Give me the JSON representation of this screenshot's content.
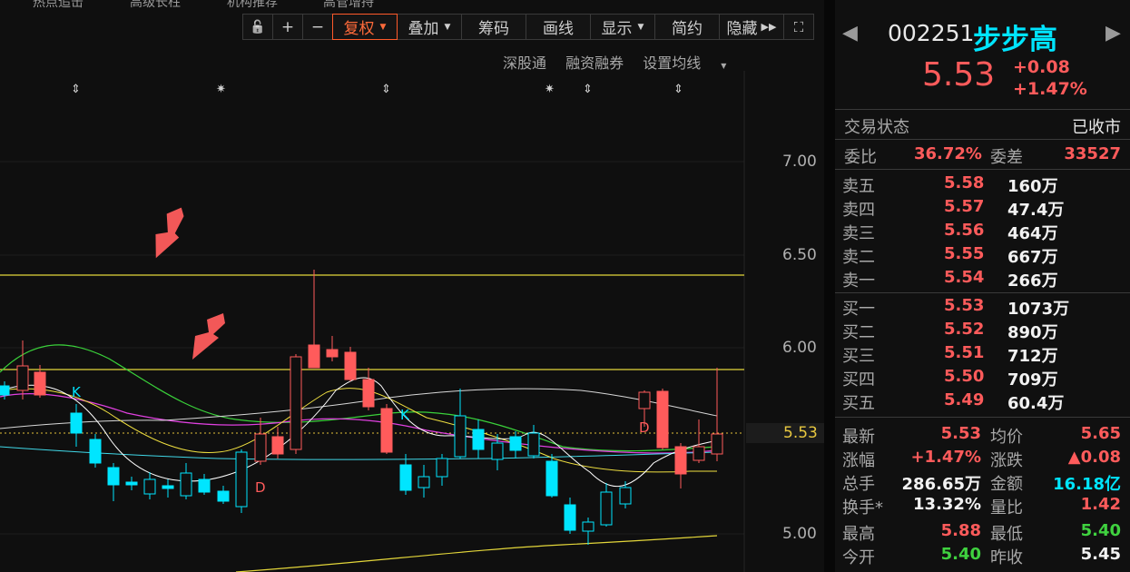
{
  "top_nav": [
    "热点追击",
    "高级长柱",
    "机构推荐",
    "高管增持"
  ],
  "toolbar": {
    "lock": "🔓",
    "plus": "+",
    "minus": "−",
    "fuquan": "复权",
    "diejia": "叠加",
    "chouma": "筹码",
    "huaxian": "画线",
    "xianshi": "显示",
    "jianyue": "简约",
    "yincang": "隐藏"
  },
  "subtoolbar": {
    "shenzhen": "深股通",
    "rongzi": "融资融券",
    "junxian": "设置均线"
  },
  "y_axis": [
    "7.00",
    "6.50",
    "6.00",
    "5.53",
    "5.00"
  ],
  "current_price_label": "5.53",
  "markers": [
    "K",
    "D",
    "K",
    "D"
  ],
  "stock": {
    "code": "002251",
    "name": "步步高",
    "price": "5.53",
    "change": "+0.08",
    "pct": "+1.47%"
  },
  "status": {
    "label": "交易状态",
    "value": "已收市"
  },
  "weibi": {
    "label": "委比",
    "value": "36.72%",
    "cha_label": "委差",
    "cha_value": "33527"
  },
  "asks": [
    {
      "label": "卖五",
      "price": "5.58",
      "vol": "160万"
    },
    {
      "label": "卖四",
      "price": "5.57",
      "vol": "47.4万"
    },
    {
      "label": "卖三",
      "price": "5.56",
      "vol": "464万"
    },
    {
      "label": "卖二",
      "price": "5.55",
      "vol": "667万"
    },
    {
      "label": "卖一",
      "price": "5.54",
      "vol": "266万"
    }
  ],
  "bids": [
    {
      "label": "买一",
      "price": "5.53",
      "vol": "1073万"
    },
    {
      "label": "买二",
      "price": "5.52",
      "vol": "890万"
    },
    {
      "label": "买三",
      "price": "5.51",
      "vol": "712万"
    },
    {
      "label": "买四",
      "price": "5.50",
      "vol": "709万"
    },
    {
      "label": "买五",
      "price": "5.49",
      "vol": "60.4万"
    }
  ],
  "stats": [
    {
      "l1": "最新",
      "v1": "5.53",
      "c1": "red",
      "l2": "均价",
      "v2": "5.65",
      "c2": "red"
    },
    {
      "l1": "涨幅",
      "v1": "+1.47%",
      "c1": "red",
      "l2": "涨跌",
      "v2": "▲0.08",
      "c2": "red"
    },
    {
      "l1": "总手",
      "v1": "286.65万",
      "c1": "white",
      "l2": "金额",
      "v2": "16.18亿",
      "c2": "cyan"
    },
    {
      "l1": "换手*",
      "v1": "13.32%",
      "c1": "white",
      "l2": "量比",
      "v2": "1.42",
      "c2": "red"
    },
    {
      "l1": "最高",
      "v1": "5.88",
      "c1": "red",
      "l2": "最低",
      "v2": "5.40",
      "c2": "green"
    },
    {
      "l1": "今开",
      "v1": "5.40",
      "c1": "green",
      "l2": "昨收",
      "v2": "5.45",
      "c2": "white"
    }
  ],
  "colors": {
    "up": "#ff5b5b",
    "down": "#00e5ff",
    "accent": "#ff6a3a",
    "name": "#00e5ff"
  }
}
